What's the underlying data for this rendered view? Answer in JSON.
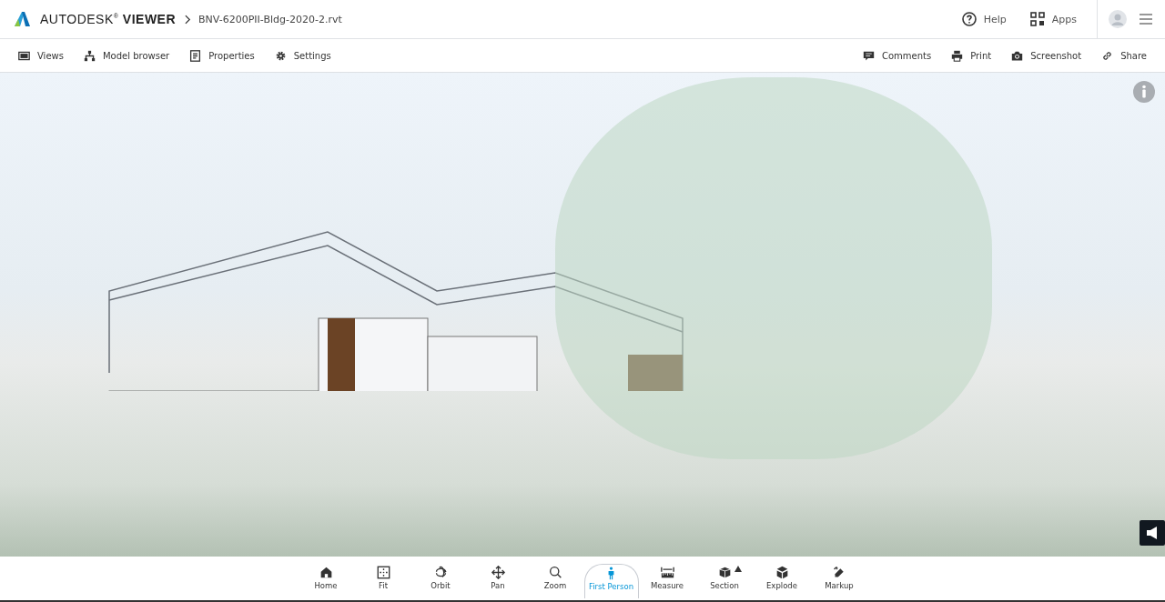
{
  "header": {
    "brand": "AUTODESK$^{®}$ **VIEWER**",
    "file_name": "BNV-6200PII-Bldg-2020-2.rvt",
    "links": [
      {
        "kind": "help",
        "label": "Help"
      },
      {
        "kind": "apps",
        "label": "Apps"
      }
    ]
  },
  "toolbar": {
    "left": [
      {
        "kind": "views",
        "label": "Views"
      },
      {
        "kind": "model",
        "label": "Model browser"
      },
      {
        "kind": "properties",
        "label": "Properties"
      },
      {
        "kind": "settings",
        "label": "Settings"
      }
    ],
    "right": [
      {
        "kind": "comments",
        "label": "Comments"
      },
      {
        "kind": "print",
        "label": "Print"
      },
      {
        "kind": "screenshot",
        "label": "Screenshot"
      },
      {
        "kind": "share",
        "label": "Share"
      }
    ]
  },
  "tools": [
    {
      "kind": "home",
      "label": "Home",
      "selected": false
    },
    {
      "kind": "fit",
      "label": "Fit",
      "selected": false
    },
    {
      "kind": "orbit",
      "label": "Orbit",
      "selected": false
    },
    {
      "kind": "pan",
      "label": "Pan",
      "selected": false
    },
    {
      "kind": "zoom",
      "label": "Zoom",
      "selected": false
    },
    {
      "kind": "person",
      "label": "First Person",
      "selected": true
    },
    {
      "kind": "measure",
      "label": "Measure",
      "selected": false
    },
    {
      "kind": "section",
      "label": "Section",
      "selected": false
    },
    {
      "kind": "explode",
      "label": "Explode",
      "selected": false
    },
    {
      "kind": "markup",
      "label": "Markup",
      "selected": false
    }
  ]
}
